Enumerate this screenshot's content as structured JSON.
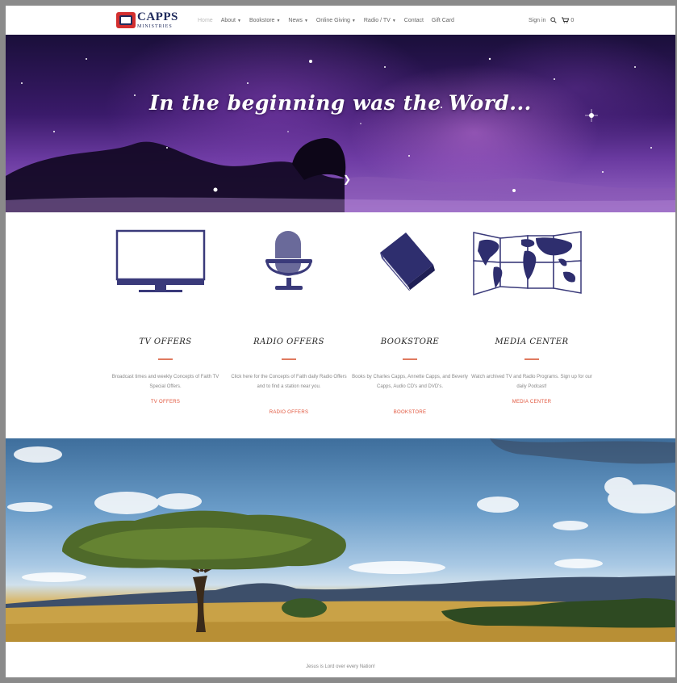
{
  "header": {
    "logo": {
      "line1": "CAPPS",
      "line2": "MINISTRIES"
    },
    "nav": [
      {
        "label": "Home",
        "dropdown": false,
        "active": true
      },
      {
        "label": "About",
        "dropdown": true
      },
      {
        "label": "Bookstore",
        "dropdown": true
      },
      {
        "label": "News",
        "dropdown": true
      },
      {
        "label": "Online Giving",
        "dropdown": true
      },
      {
        "label": "Radio / TV",
        "dropdown": true
      },
      {
        "label": "Contact",
        "dropdown": false
      },
      {
        "label": "Gift Card",
        "dropdown": false
      }
    ],
    "sign_in": "Sign in",
    "cart_count": "0"
  },
  "hero": {
    "title": "In the beginning was the Word..."
  },
  "offers": [
    {
      "title": "TV OFFERS",
      "description": "Broadcast times and weekly Concepts of Faith TV Special Offers.",
      "link": "TV OFFERS",
      "icon": "tv-icon"
    },
    {
      "title": "RADIO OFFERS",
      "description": "Click here for the Concepts of Faith daily Radio Offers and to find a station near you.",
      "link": "RADIO OFFERS",
      "icon": "microphone-icon"
    },
    {
      "title": "BOOKSTORE",
      "description": "Books by Charles Capps, Annette Capps, and Beverly Capps, Audio CD's and DVD's.",
      "link": "BOOKSTORE",
      "icon": "book-icon"
    },
    {
      "title": "MEDIA CENTER",
      "description": "Watch archived TV and Radio Programs. Sign up for our daily Podcast!",
      "link": "MEDIA CENTER",
      "icon": "world-map-icon"
    }
  ],
  "footer": {
    "caption": "Jesus is Lord over every Nation!"
  },
  "colors": {
    "accent": "#e0533a",
    "brand": "#1f2a5c",
    "icon": "#3a3a7a"
  }
}
